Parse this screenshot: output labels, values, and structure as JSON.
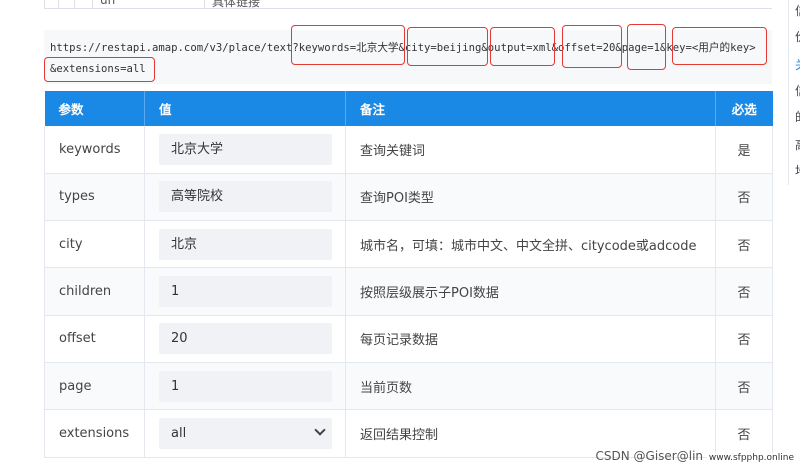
{
  "top_fragment": {
    "left_text": "un",
    "right_text": "具体链接"
  },
  "url": {
    "line1": "https://restapi.amap.com/v3/place/text?keywords=北京大学&city=beijing&output=xml&offset=20&page=1&key=<用户的key>",
    "line2": "&extensions=all"
  },
  "table": {
    "headers": [
      "参数",
      "值",
      "备注",
      "必选"
    ],
    "rows": [
      {
        "param": "keywords",
        "value": "北京大学",
        "note": "查询关键词",
        "required": "是"
      },
      {
        "param": "types",
        "value": "高等院校",
        "note": "查询POI类型",
        "required": "否"
      },
      {
        "param": "city",
        "value": "北京",
        "note": "城市名，可填：城市中文、中文全拼、citycode或adcode",
        "required": "否"
      },
      {
        "param": "children",
        "value": "1",
        "note": "按照层级展示子POI数据",
        "required": "否"
      },
      {
        "param": "offset",
        "value": "20",
        "note": "每页记录数据",
        "required": "否"
      },
      {
        "param": "page",
        "value": "1",
        "note": "当前页数",
        "required": "否"
      },
      {
        "param": "extensions",
        "value": "all",
        "note": "返回结果控制",
        "required": "否"
      }
    ]
  },
  "toc_chars": [
    "信",
    "价",
    "关",
    "信",
    "的",
    "高",
    "地"
  ],
  "watermark": {
    "main": "CSDN @Giser@lin",
    "small": "www.sfpphp.online"
  },
  "colors": {
    "header_bg": "#1a89e6",
    "annotation": "#e53935",
    "code_bg": "#f6f8fa"
  }
}
